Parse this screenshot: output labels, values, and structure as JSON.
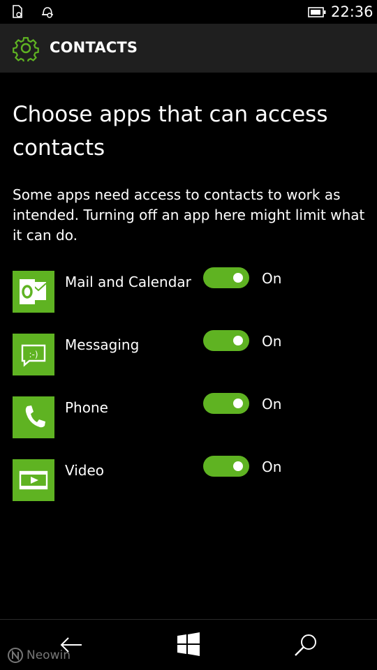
{
  "status_bar": {
    "time": "22:36",
    "icons": [
      "location-doc-icon",
      "alarm-quiet-icon",
      "battery-icon"
    ]
  },
  "header": {
    "icon": "gear-icon",
    "title": "CONTACTS"
  },
  "heading": "Choose apps that can access contacts",
  "description": "Some apps need access to contacts to work as intended. Turning off an app here might limit what it can do.",
  "apps": [
    {
      "name": "Mail and Calendar",
      "icon": "outlook-mail-icon",
      "state": "On",
      "enabled": true
    },
    {
      "name": "Messaging",
      "icon": "messaging-icon",
      "state": "On",
      "enabled": true
    },
    {
      "name": "Phone",
      "icon": "phone-icon",
      "state": "On",
      "enabled": true
    },
    {
      "name": "Video",
      "icon": "video-icon",
      "state": "On",
      "enabled": true
    }
  ],
  "nav_bar": {
    "buttons": [
      "back-arrow-icon",
      "windows-start-icon",
      "search-icon"
    ]
  },
  "watermark": {
    "text": "Neowin"
  },
  "colors": {
    "accent": "#5fb322",
    "background": "#000000",
    "header_background": "#1f1f1f"
  }
}
